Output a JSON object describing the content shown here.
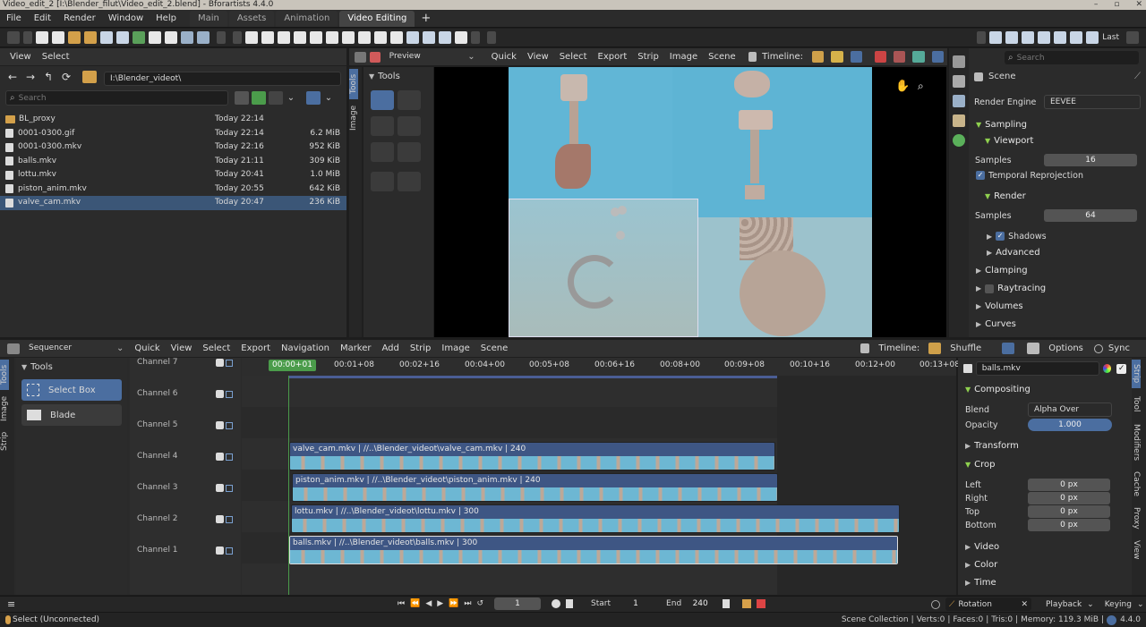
{
  "window": {
    "title": "Video_edit_2 [I:\\Blender_filut\\Video_edit_2.blend] - Bforartists 4.4.0"
  },
  "menubar": {
    "menus": [
      "File",
      "Edit",
      "Render",
      "Window",
      "Help"
    ],
    "workspaces": [
      "Main",
      "Assets",
      "Animation",
      "Video Editing"
    ],
    "active_workspace": "Video Editing",
    "add_tab": "+"
  },
  "toolbar": {
    "last_label": "Last"
  },
  "file_browser": {
    "menus": [
      "View",
      "Select"
    ],
    "path": "I:\\Blender_videot\\",
    "search_placeholder": "Search",
    "files": [
      {
        "name": "BL_proxy",
        "date": "Today 22:14",
        "size": "",
        "folder": true
      },
      {
        "name": "0001-0300.gif",
        "date": "Today 22:14",
        "size": "6.2 MiB"
      },
      {
        "name": "0001-0300.mkv",
        "date": "Today 22:16",
        "size": "952 KiB"
      },
      {
        "name": "balls.mkv",
        "date": "Today 21:11",
        "size": "309 KiB"
      },
      {
        "name": "lottu.mkv",
        "date": "Today 20:41",
        "size": "1.0 MiB"
      },
      {
        "name": "piston_anim.mkv",
        "date": "Today 20:55",
        "size": "642 KiB"
      },
      {
        "name": "valve_cam.mkv",
        "date": "Today 20:47",
        "size": "236 KiB",
        "selected": true
      }
    ]
  },
  "preview": {
    "mode": "Preview",
    "menus": [
      "Quick",
      "View",
      "Select",
      "Export",
      "Strip",
      "Image",
      "Scene"
    ],
    "timeline_label": "Timeline:",
    "tabs": [
      "Tools",
      "Image"
    ],
    "tools_title": "Tools"
  },
  "properties": {
    "search_placeholder": "Search",
    "scene": "Scene",
    "render_engine_label": "Render Engine",
    "render_engine": "EEVEE",
    "sampling": "Sampling",
    "viewport": "Viewport",
    "samples_label": "Samples",
    "viewport_samples": "16",
    "temporal": "Temporal Reprojection",
    "render": "Render",
    "render_samples": "64",
    "shadows": "Shadows",
    "advanced": "Advanced",
    "clamping": "Clamping",
    "raytracing": "Raytracing",
    "volumes": "Volumes",
    "curves": "Curves"
  },
  "sequencer": {
    "mode": "Sequencer",
    "menus": [
      "Quick",
      "View",
      "Select",
      "Export",
      "Navigation",
      "Marker",
      "Add",
      "Strip",
      "Image",
      "Scene"
    ],
    "timeline_label": "Timeline:",
    "shuffle": "Shuffle",
    "options": "Options",
    "sync": "Sync",
    "tabs": [
      "Tools",
      "Image",
      "Strip"
    ],
    "tools_title": "Tools",
    "tool_select": "Select Box",
    "tool_blade": "Blade",
    "current_time": "00:00+01",
    "ticks": [
      "00:01+08",
      "00:02+16",
      "00:04+00",
      "00:05+08",
      "00:06+16",
      "00:08+00",
      "00:09+08",
      "00:10+16",
      "00:12+00",
      "00:13+08"
    ],
    "channels": [
      "Channel 7",
      "Channel 6",
      "Channel 5",
      "Channel 4",
      "Channel 3",
      "Channel 2",
      "Channel 1"
    ],
    "strips": [
      {
        "label": "valve_cam.mkv | //..\\Blender_videot\\valve_cam.mkv | 240"
      },
      {
        "label": "piston_anim.mkv | //..\\Blender_videot\\piston_anim.mkv | 240"
      },
      {
        "label": "lottu.mkv | //..\\Blender_videot\\lottu.mkv | 300"
      },
      {
        "label": "balls.mkv | //..\\Blender_videot\\balls.mkv | 300"
      }
    ]
  },
  "strip_panel": {
    "name": "balls.mkv",
    "compositing": "Compositing",
    "blend_label": "Blend",
    "blend": "Alpha Over",
    "opacity_label": "Opacity",
    "opacity": "1.000",
    "transform": "Transform",
    "crop": "Crop",
    "left_label": "Left",
    "left": "0 px",
    "right_label": "Right",
    "right": "0 px",
    "top_label": "Top",
    "top": "0 px",
    "bottom_label": "Bottom",
    "bottom": "0 px",
    "video": "Video",
    "color": "Color",
    "time": "Time",
    "tabs": [
      "Strip",
      "Tool",
      "Modifiers",
      "Cache",
      "Proxy",
      "View"
    ]
  },
  "playback": {
    "frame": "1",
    "start_label": "Start",
    "start": "1",
    "end_label": "End",
    "end": "240",
    "keying_set": "Rotation",
    "playback": "Playback",
    "keying": "Keying"
  },
  "status": {
    "left": "Select (Unconnected)",
    "collection": "Scene Collection",
    "verts": "Verts:0",
    "faces": "Faces:0",
    "tris": "Tris:0",
    "memory": "Memory: 119.3 MiB",
    "version": "4.4.0"
  }
}
